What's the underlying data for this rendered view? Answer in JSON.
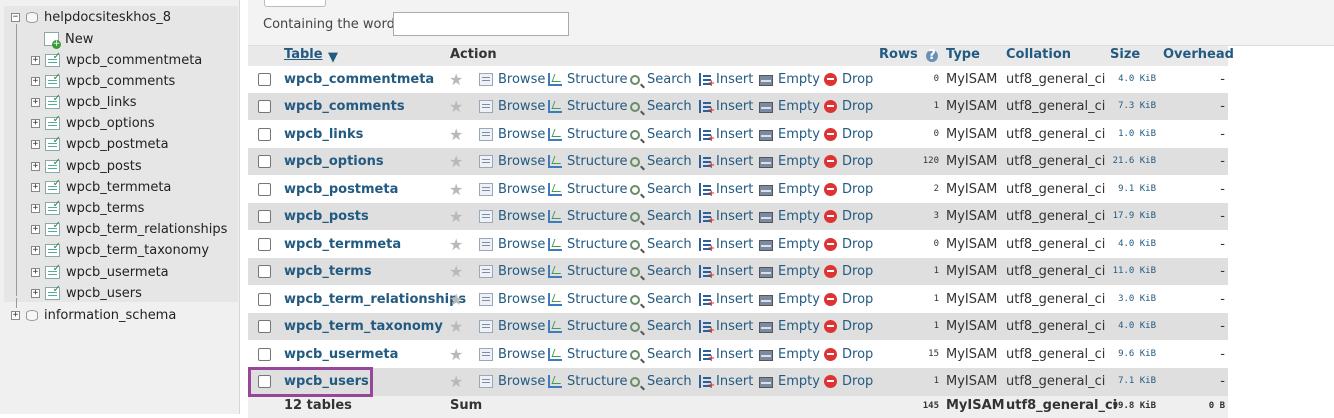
{
  "nav": {
    "database": "helpdocsiteskhos_8",
    "new_label": "New",
    "tables": [
      "wpcb_commentmeta",
      "wpcb_comments",
      "wpcb_links",
      "wpcb_options",
      "wpcb_postmeta",
      "wpcb_posts",
      "wpcb_termmeta",
      "wpcb_terms",
      "wpcb_term_relationships",
      "wpcb_term_taxonomy",
      "wpcb_usermeta",
      "wpcb_users"
    ],
    "other_database": "information_schema"
  },
  "filter": {
    "label": "Containing the word:",
    "value": ""
  },
  "header": {
    "table": "Table",
    "action": "Action",
    "rows": "Rows",
    "type": "Type",
    "collation": "Collation",
    "size": "Size",
    "overhead": "Overhead"
  },
  "actions": {
    "browse": "Browse",
    "structure": "Structure",
    "search": "Search",
    "insert": "Insert",
    "empty": "Empty",
    "drop": "Drop"
  },
  "rows": [
    {
      "name": "wpcb_commentmeta",
      "rows": "0",
      "type": "MyISAM",
      "collation": "utf8_general_ci",
      "size": "4.0 KiB",
      "overhead": "-"
    },
    {
      "name": "wpcb_comments",
      "rows": "1",
      "type": "MyISAM",
      "collation": "utf8_general_ci",
      "size": "7.3 KiB",
      "overhead": "-"
    },
    {
      "name": "wpcb_links",
      "rows": "0",
      "type": "MyISAM",
      "collation": "utf8_general_ci",
      "size": "1.0 KiB",
      "overhead": "-"
    },
    {
      "name": "wpcb_options",
      "rows": "120",
      "type": "MyISAM",
      "collation": "utf8_general_ci",
      "size": "21.6 KiB",
      "overhead": "-"
    },
    {
      "name": "wpcb_postmeta",
      "rows": "2",
      "type": "MyISAM",
      "collation": "utf8_general_ci",
      "size": "9.1 KiB",
      "overhead": "-"
    },
    {
      "name": "wpcb_posts",
      "rows": "3",
      "type": "MyISAM",
      "collation": "utf8_general_ci",
      "size": "17.9 KiB",
      "overhead": "-"
    },
    {
      "name": "wpcb_termmeta",
      "rows": "0",
      "type": "MyISAM",
      "collation": "utf8_general_ci",
      "size": "4.0 KiB",
      "overhead": "-"
    },
    {
      "name": "wpcb_terms",
      "rows": "1",
      "type": "MyISAM",
      "collation": "utf8_general_ci",
      "size": "11.0 KiB",
      "overhead": "-"
    },
    {
      "name": "wpcb_term_relationships",
      "rows": "1",
      "type": "MyISAM",
      "collation": "utf8_general_ci",
      "size": "3.0 KiB",
      "overhead": "-"
    },
    {
      "name": "wpcb_term_taxonomy",
      "rows": "1",
      "type": "MyISAM",
      "collation": "utf8_general_ci",
      "size": "4.0 KiB",
      "overhead": "-"
    },
    {
      "name": "wpcb_usermeta",
      "rows": "15",
      "type": "MyISAM",
      "collation": "utf8_general_ci",
      "size": "9.6 KiB",
      "overhead": "-"
    },
    {
      "name": "wpcb_users",
      "rows": "1",
      "type": "MyISAM",
      "collation": "utf8_general_ci",
      "size": "7.1 KiB",
      "overhead": "-"
    }
  ],
  "footer": {
    "count": "12 tables",
    "sum": "Sum",
    "rows": "145",
    "type": "MyISAM",
    "collation": "utf8_general_ci",
    "size": "99.8 KiB",
    "overhead": "0 B"
  },
  "highlighted_table": "wpcb_users",
  "colors": {
    "link": "#235a81",
    "highlight_border": "#96479a",
    "row_alt": "#dfdfdf"
  }
}
